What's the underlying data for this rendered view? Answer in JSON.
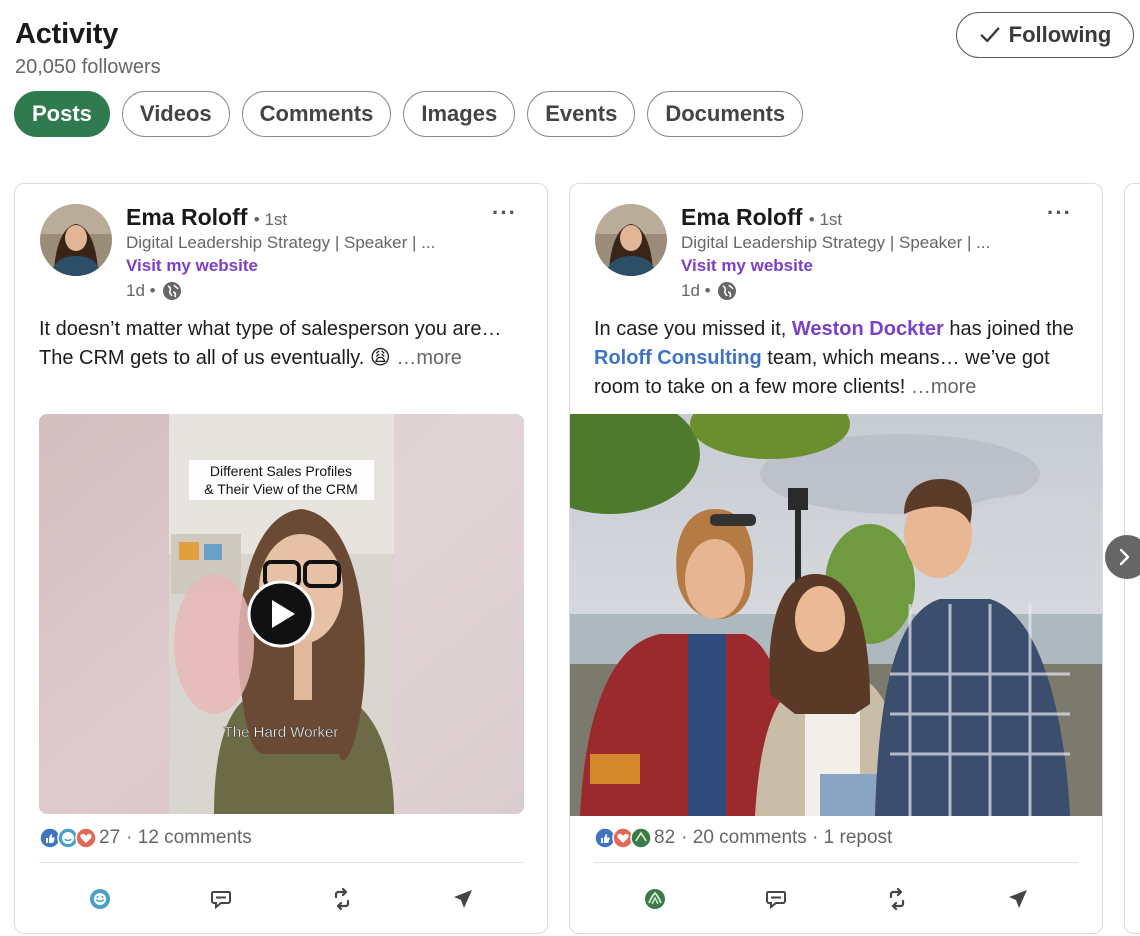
{
  "header": {
    "title": "Activity",
    "followers": "20,050 followers",
    "follow_button": "Following"
  },
  "tabs": [
    {
      "label": "Posts",
      "active": true
    },
    {
      "label": "Videos",
      "active": false
    },
    {
      "label": "Comments",
      "active": false
    },
    {
      "label": "Images",
      "active": false
    },
    {
      "label": "Events",
      "active": false
    },
    {
      "label": "Documents",
      "active": false
    }
  ],
  "posts": [
    {
      "author": "Ema Roloff",
      "degree": "• 1st",
      "headline": "Digital Leadership Strategy | Speaker | ...",
      "website": "Visit my website",
      "time": "1d •",
      "text": {
        "line1": "It doesn’t matter what type of salesperson you are…",
        "line2": "The CRM gets to all of us eventually. 😩",
        "more": "…more"
      },
      "video": {
        "overlay_title_1": "Different Sales Profiles",
        "overlay_title_2": "& Their View of the CRM",
        "caption": "The Hard Worker"
      },
      "reaction_count": "27",
      "comments": "· 12 comments"
    },
    {
      "author": "Ema Roloff",
      "degree": "• 1st",
      "headline": "Digital Leadership Strategy | Speaker | ...",
      "website": "Visit my website",
      "time": "1d •",
      "text": {
        "pre": "In case you missed it,",
        "mention": "Weston Dockter",
        "mid": "has joined the",
        "company": "Roloff Consulting",
        "post": "team, which means… we’ve got room to take on a few more clients!",
        "more": "…more"
      },
      "reaction_count": "82",
      "comments": "· 20 comments · 1 repost"
    }
  ],
  "colors": {
    "active_tab": "#2f7a4f",
    "link_purple": "#7b3fc8",
    "company_blue": "#3f74c4"
  },
  "icons": {
    "follow": "check-icon",
    "time": "globe-icon",
    "actions": [
      "react-icon",
      "comment-icon",
      "repost-icon",
      "send-icon"
    ],
    "next": "chevron-right-icon"
  }
}
